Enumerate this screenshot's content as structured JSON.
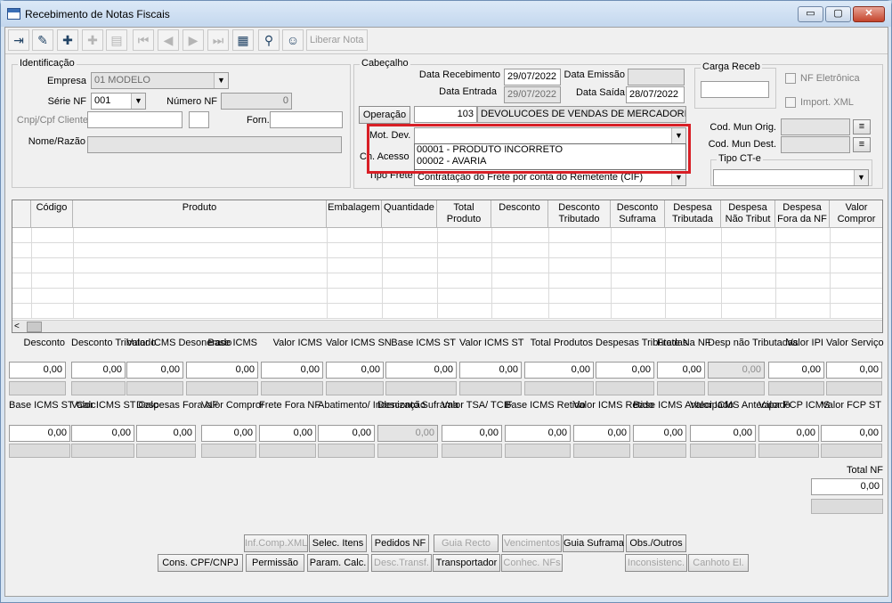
{
  "window": {
    "title": "Recebimento de Notas Fiscais",
    "min": "▭",
    "max": "▢",
    "close": "✕"
  },
  "toolbar": {
    "liberar_nota": "Liberar Nota"
  },
  "identificacao": {
    "title": "Identificação",
    "empresa_label": "Empresa",
    "empresa_value": "01 MODELO",
    "serie_label": "Série NF",
    "serie_value": "001",
    "numero_label": "Número NF",
    "numero_value": "0",
    "cnpj_label": "Cnpj/Cpf Cliente",
    "forn_label": "Forn.",
    "nome_label": "Nome/Razão"
  },
  "cabecalho": {
    "title": "Cabeçalho",
    "data_recebimento_label": "Data Recebimento",
    "data_recebimento_value": "29/07/2022",
    "data_emissao_label": "Data Emissão",
    "data_entrada_label": "Data Entrada",
    "data_entrada_value": "29/07/2022",
    "data_saida_label": "Data Saída",
    "data_saida_value": "28/07/2022",
    "operacao_button": "Operação",
    "operacao_code": "103",
    "operacao_desc": "DEVOLUCOES DE VENDAS DE MERCADORIA",
    "mot_dev_label": "Mot. Dev.",
    "ch_acesso_label": "Ch. Acesso",
    "tipo_frete_label": "Tipo Frete",
    "tipo_frete_value": "Contratação do Frete por conta do Remetente (CIF)",
    "mot_dev_options": [
      "00001 - PRODUTO INCORRETO",
      "00002 - AVARIA"
    ],
    "carga_receb_label": "Carga Receb",
    "nf_eletronica_label": "NF Eletrônica",
    "import_xml_label": "Import. XML",
    "cod_mun_orig_label": "Cod. Mun Orig.",
    "cod_mun_dest_label": "Cod. Mun Dest.",
    "tipo_cte_label": "Tipo CT-e"
  },
  "grid": {
    "columns": [
      "",
      "Código",
      "Produto",
      "Embalagem",
      "Quantidade",
      "Total Produto",
      "Desconto",
      "Desconto Tributado",
      "Desconto Suframa",
      "Despesa Tributada",
      "Despesa Não Tribut",
      "Despesa Fora da NF",
      "Valor Compror"
    ]
  },
  "totals_row1": {
    "labels": [
      "Desconto",
      "Desconto Tributado",
      "Valor ICMS Desonerado",
      "Base ICMS",
      "Valor ICMS",
      "Valor ICMS SN",
      "Base ICMS ST",
      "Valor ICMS ST",
      "Total Produtos",
      "Despesas Tributadas",
      "Frete Na NF",
      "Desp não Tributadas",
      "Valor IPI",
      "Valor Serviço"
    ],
    "values": [
      "0,00",
      "0,00",
      "0,00",
      "0,00",
      "0,00",
      "0,00",
      "0,00",
      "0,00",
      "0,00",
      "0,00",
      "0,00",
      "0,00",
      "0,00",
      "0,00"
    ]
  },
  "totals_row2": {
    "labels": [
      "Base ICMS ST Calc",
      "Valor ICMS ST Calc",
      "Despesas Fora NF",
      "Valor Compror",
      "Frete Fora NF",
      "Abatimento/ Indenização",
      "Desconto Suframa",
      "Valor TSA/ TCIF",
      "Base ICMS Retido",
      "Valor ICMS Retido",
      "Base ICMS Antecipado",
      "Valor ICMS Antecipado",
      "Valor FCP ICMS",
      "Valor FCP ST"
    ],
    "values": [
      "0,00",
      "0,00",
      "0,00",
      "0,00",
      "0,00",
      "0,00",
      "0,00",
      "0,00",
      "0,00",
      "0,00",
      "0,00",
      "0,00",
      "0,00",
      "0,00"
    ]
  },
  "total_nf": {
    "label": "Total NF",
    "value": "0,00"
  },
  "buttons_row1": [
    "Inf.Comp.XML",
    "Selec. Itens",
    "Pedidos NF",
    "Guia Recto",
    "Vencimentos",
    "Guia Suframa",
    "Obs./Outros"
  ],
  "buttons_row2": [
    "Cons. CPF/CNPJ",
    "Permissão",
    "Param. Calc.",
    "Desc.Transf.",
    "Transportador",
    "Conhec. NFs",
    "Inconsistenc.",
    "Canhoto El."
  ]
}
